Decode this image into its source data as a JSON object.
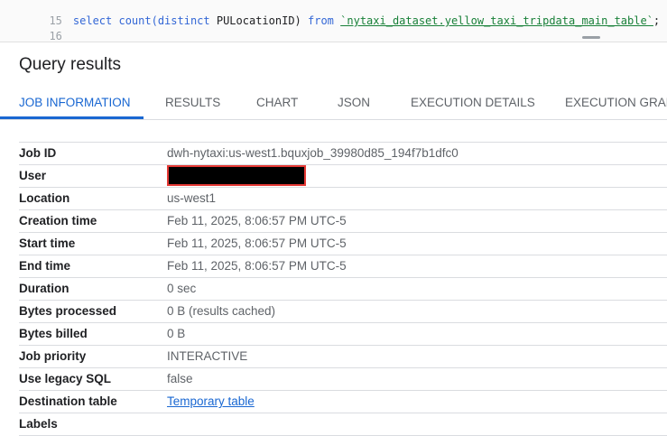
{
  "editor": {
    "lines": [
      {
        "number": "15",
        "kw1": "select count(distinct",
        "mid": " PULocationID) ",
        "kw2": "from",
        "table": "`nytaxi_dataset.yellow_taxi_tripdata_main_table`",
        "end": ";"
      },
      {
        "number": "16"
      }
    ]
  },
  "results": {
    "title": "Query results",
    "tabs": [
      "JOB INFORMATION",
      "RESULTS",
      "CHART",
      "JSON",
      "EXECUTION DETAILS",
      "EXECUTION GRAPH"
    ],
    "active_tab": "JOB INFORMATION"
  },
  "job_info": {
    "job_id": {
      "label": "Job ID",
      "value": "dwh-nytaxi:us-west1.bquxjob_39980d85_194f7b1dfc0"
    },
    "user": {
      "label": "User",
      "value": ""
    },
    "location": {
      "label": "Location",
      "value": "us-west1"
    },
    "creation_time": {
      "label": "Creation time",
      "value": "Feb 11, 2025, 8:06:57 PM UTC-5"
    },
    "start_time": {
      "label": "Start time",
      "value": "Feb 11, 2025, 8:06:57 PM UTC-5"
    },
    "end_time": {
      "label": "End time",
      "value": "Feb 11, 2025, 8:06:57 PM UTC-5"
    },
    "duration": {
      "label": "Duration",
      "value": "0 sec"
    },
    "bytes_processed": {
      "label": "Bytes processed",
      "value": "0 B (results cached)"
    },
    "bytes_billed": {
      "label": "Bytes billed",
      "value": "0 B"
    },
    "job_priority": {
      "label": "Job priority",
      "value": "INTERACTIVE"
    },
    "legacy_sql": {
      "label": "Use legacy SQL",
      "value": "false"
    },
    "destination_table": {
      "label": "Destination table",
      "value": "Temporary table"
    },
    "labels": {
      "label": "Labels",
      "value": ""
    }
  },
  "colors": {
    "accent": "#1967d2",
    "redaction_border": "#e53935"
  }
}
